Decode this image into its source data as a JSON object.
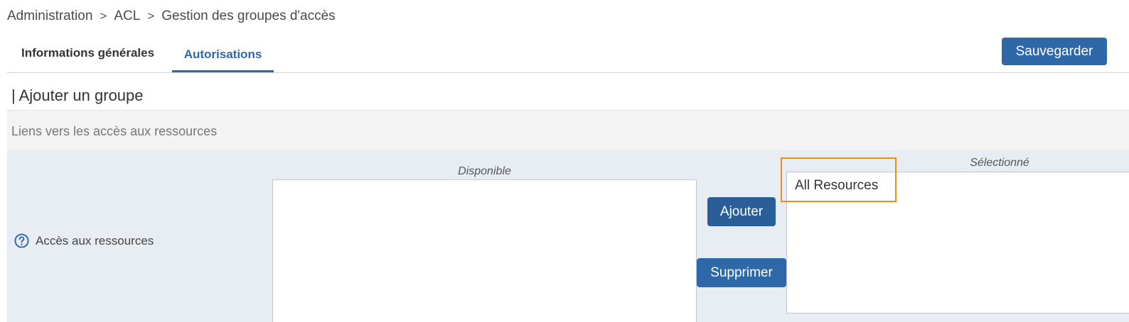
{
  "breadcrumb": {
    "items": [
      "Administration",
      "ACL",
      "Gestion des groupes d'accès"
    ],
    "separator": ">"
  },
  "tabs": [
    {
      "label": "Informations générales",
      "active": false
    },
    {
      "label": "Autorisations",
      "active": true
    }
  ],
  "toolbar": {
    "save_label": "Sauvegarder"
  },
  "section": {
    "title": "| Ajouter un groupe",
    "subheader": "Liens vers les accès aux ressources"
  },
  "field": {
    "label": "Accès aux ressources",
    "available_caption": "Disponible",
    "selected_caption": "Sélectionné",
    "available_items": [],
    "selected_items": [
      "All Resources"
    ],
    "add_label": "Ajouter",
    "remove_label": "Supprimer"
  },
  "icons": {
    "help": "help-circle-icon"
  },
  "colors": {
    "primary": "#2e68a8",
    "active_tab": "#2d6aa8",
    "highlight": "#f08a1c",
    "row_background": "#e8edf3",
    "subheader_background": "#f3f3f3"
  }
}
